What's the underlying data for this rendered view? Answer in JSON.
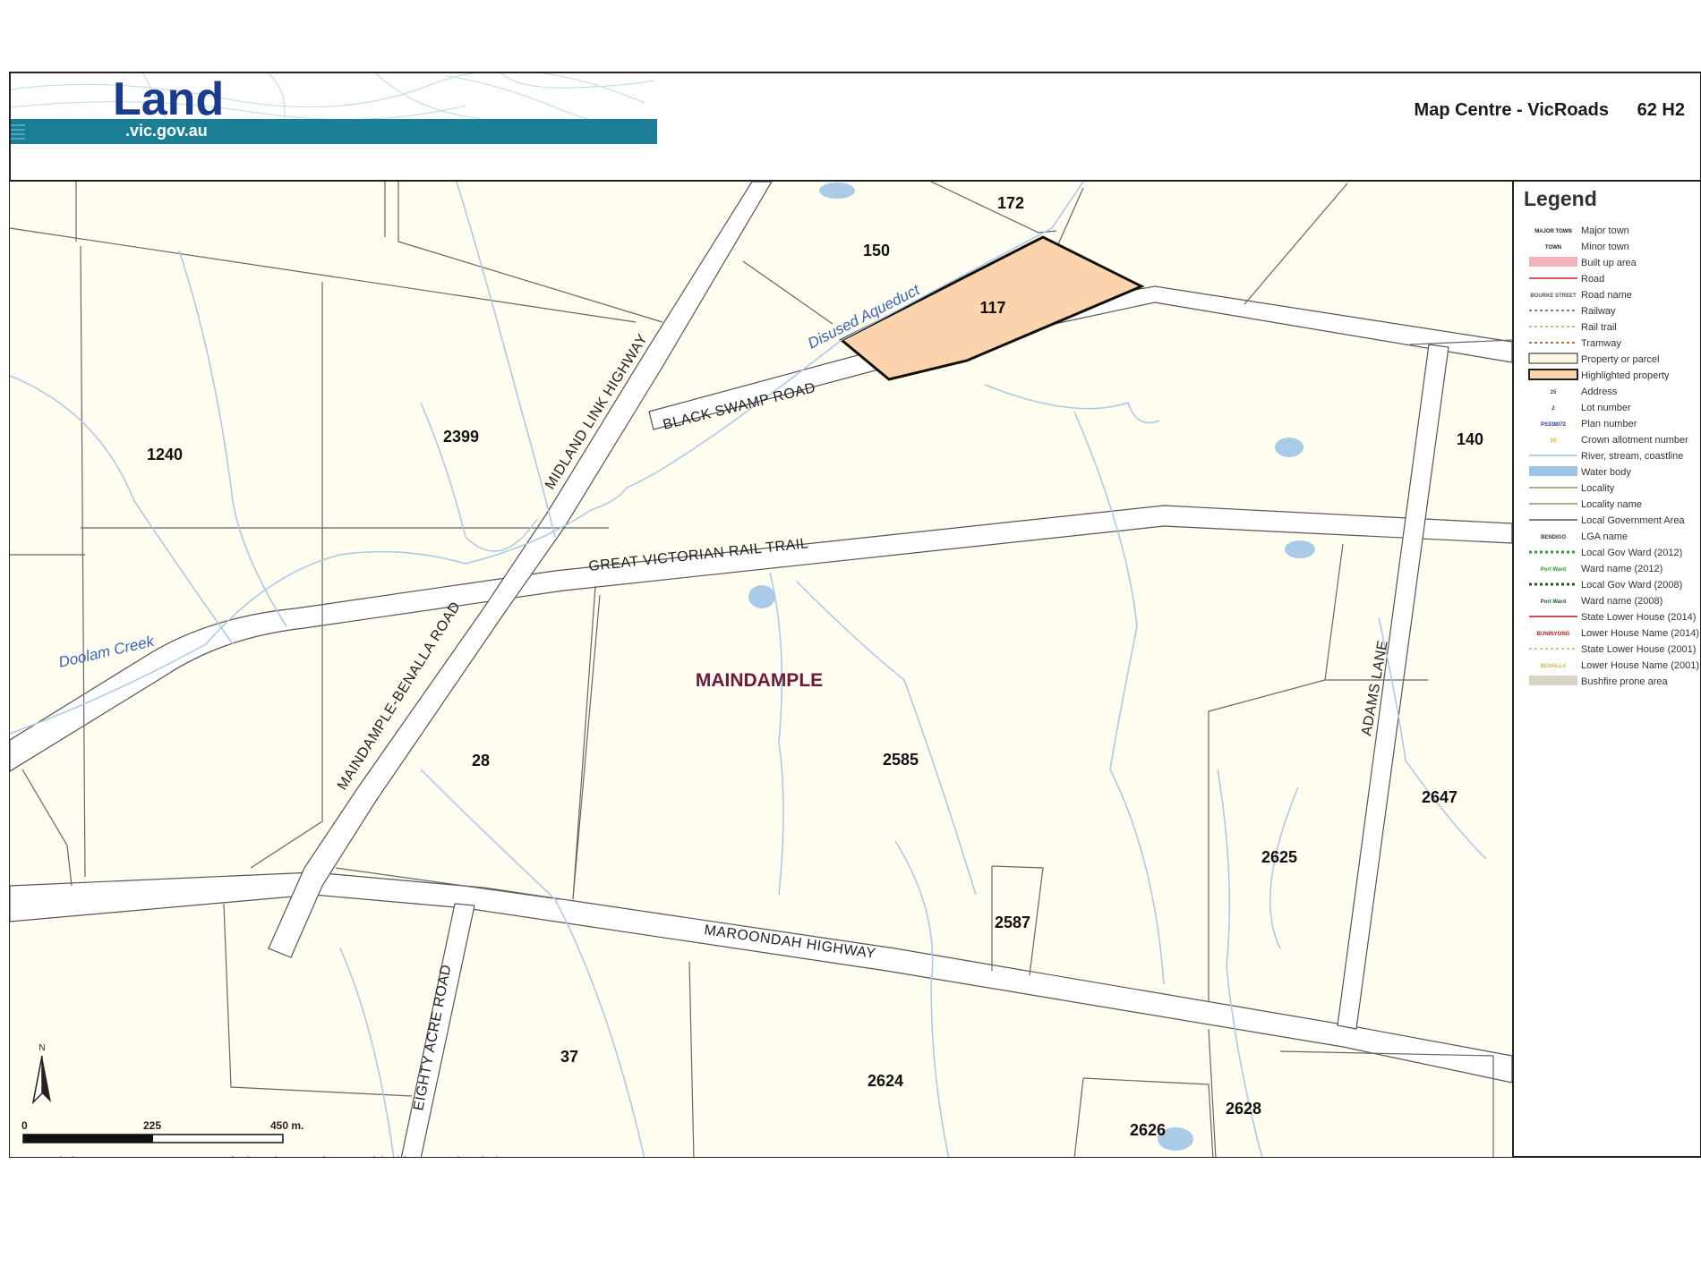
{
  "header": {
    "logo_word": "Land",
    "logo_domain": ".vic.gov.au",
    "map_centre": "Map Centre - VicRoads",
    "map_ref": "62 H2"
  },
  "legend": {
    "title": "Legend",
    "items": [
      {
        "label": "Major town",
        "sym": "MAJOR TOWN",
        "sym_color": "#222222"
      },
      {
        "label": "Minor town",
        "sym": "TOWN",
        "sym_color": "#222222"
      },
      {
        "label": "Built up area",
        "sym": "",
        "sym_color": "#f4b3b8"
      },
      {
        "label": "Road",
        "sym": "",
        "sym_color": "#c62828"
      },
      {
        "label": "Road name",
        "sym": "BOURKE STREET",
        "sym_color": "#555555"
      },
      {
        "label": "Railway",
        "sym": "",
        "sym_color": "#555555"
      },
      {
        "label": "Rail trail",
        "sym": "",
        "sym_color": "#8bc34a"
      },
      {
        "label": "Tramway",
        "sym": "",
        "sym_color": "#8b4513"
      },
      {
        "label": "Property or parcel",
        "sym": "",
        "sym_color": "#fff9e6"
      },
      {
        "label": "Highlighted property",
        "sym": "",
        "sym_color": "#fbd4ad"
      },
      {
        "label": "Address",
        "sym": "25",
        "sym_color": "#444444"
      },
      {
        "label": "Lot number",
        "sym": "2",
        "sym_color": "#1a3c8f"
      },
      {
        "label": "Plan number",
        "sym": "PS338072",
        "sym_color": "#1a3c8f"
      },
      {
        "label": "Crown allotment number",
        "sym": "10",
        "sym_color": "#e6a817"
      },
      {
        "label": "River, stream, coastline",
        "sym": "",
        "sym_color": "#9ec4e6"
      },
      {
        "label": "Water body",
        "sym": "",
        "sym_color": "#9ec4e6"
      },
      {
        "label": "Locality",
        "sym": "",
        "sym_color": "#8a9a5b"
      },
      {
        "label": "Locality name",
        "sym": "",
        "sym_color": "#8a9a5b"
      },
      {
        "label": "Local Government Area",
        "sym": "",
        "sym_color": "#555555"
      },
      {
        "label": "LGA name",
        "sym": "BENDIGO",
        "sym_color": "#333333"
      },
      {
        "label": "Local Gov Ward (2012)",
        "sym": "",
        "sym_color": "#2e9e2e"
      },
      {
        "label": "Ward name (2012)",
        "sym": "Port Ward",
        "sym_color": "#2e9e2e"
      },
      {
        "label": "Local Gov Ward (2008)",
        "sym": "",
        "sym_color": "#1b5e20"
      },
      {
        "label": "Ward name (2008)",
        "sym": "Port Ward",
        "sym_color": "#1b5e20"
      },
      {
        "label": "State Lower House (2014)",
        "sym": "",
        "sym_color": "#b71c1c"
      },
      {
        "label": "Lower House Name (2014)",
        "sym": "BUNINYONG",
        "sym_color": "#b71c1c"
      },
      {
        "label": "State Lower House (2001)",
        "sym": "",
        "sym_color": "#c9b458"
      },
      {
        "label": "Lower House Name (2001)",
        "sym": "BENALLA",
        "sym_color": "#c9b458"
      },
      {
        "label": "Bushfire prone area",
        "sym": "",
        "sym_color": "#d9d6c8"
      }
    ]
  },
  "map": {
    "locality": "MAINDAMPLE",
    "lots": [
      "172",
      "150",
      "117",
      "2399",
      "1240",
      "140",
      "28",
      "2585",
      "2647",
      "2625",
      "2587",
      "37",
      "2624",
      "2628",
      "2626"
    ],
    "roads": [
      "BLACK SWAMP ROAD",
      "MIDLAND LINK HIGHWAY",
      "GREAT VICTORIAN RAIL TRAIL",
      "MAINDAMPLE-BENALLA ROAD",
      "MAROONDAH HIGHWAY",
      "EIGHTY ACRE ROAD",
      "ADAMS LANE"
    ],
    "waterways": [
      "Disused Aqueduct",
      "Doolam Creek"
    ],
    "north_label": "N",
    "scale_labels": [
      "0",
      "225",
      "450 m."
    ],
    "copyright": "Copyright © State Government of Victoria. Service provided by www.land.vic.gov.au"
  },
  "colors": {
    "accent_teal": "#1a7f95",
    "logo_blue": "#1a3c8f",
    "highlight_fill": "#fbd4ad",
    "parcel_fill": "#fffcf0",
    "water": "#9ec4e6",
    "locality_text": "#6d1a3e"
  }
}
